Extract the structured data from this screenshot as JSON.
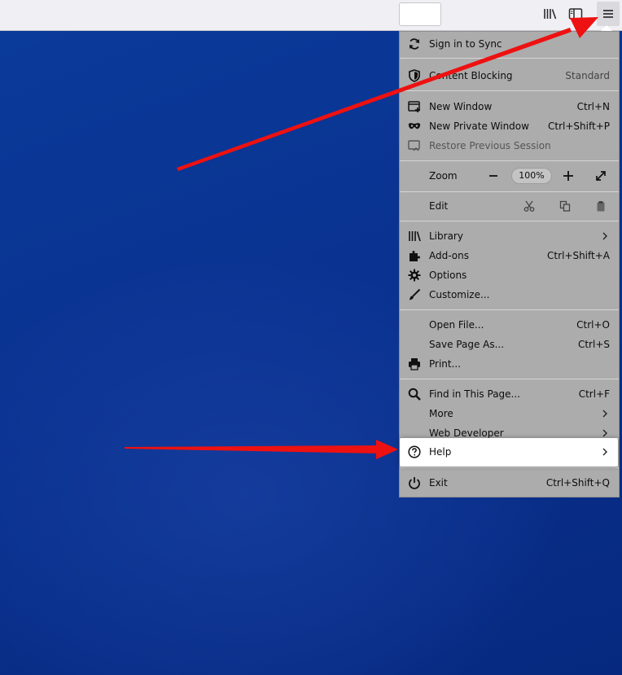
{
  "menu": {
    "sign_in": "Sign in to Sync",
    "content_blocking": {
      "label": "Content Blocking",
      "value": "Standard"
    },
    "new_window": {
      "label": "New Window",
      "shortcut": "Ctrl+N"
    },
    "new_private_window": {
      "label": "New Private Window",
      "shortcut": "Ctrl+Shift+P"
    },
    "restore_session": {
      "label": "Restore Previous Session"
    },
    "zoom": {
      "label": "Zoom",
      "minus": "−",
      "value": "100%",
      "plus": "+"
    },
    "edit": {
      "label": "Edit"
    },
    "library": {
      "label": "Library"
    },
    "addons": {
      "label": "Add-ons",
      "shortcut": "Ctrl+Shift+A"
    },
    "options": {
      "label": "Options"
    },
    "customize": {
      "label": "Customize..."
    },
    "open_file": {
      "label": "Open File...",
      "shortcut": "Ctrl+O"
    },
    "save_page": {
      "label": "Save Page As...",
      "shortcut": "Ctrl+S"
    },
    "print": {
      "label": "Print..."
    },
    "find": {
      "label": "Find in This Page...",
      "shortcut": "Ctrl+F"
    },
    "more": {
      "label": "More"
    },
    "web_developer": {
      "label": "Web Developer"
    },
    "help": {
      "label": "Help"
    },
    "exit": {
      "label": "Exit",
      "shortcut": "Ctrl+Shift+Q"
    }
  },
  "icons": {
    "toolbar": [
      "library-icon",
      "sidebar-icon",
      "hamburger-menu-icon"
    ],
    "annotation_color": "#ee1111"
  }
}
